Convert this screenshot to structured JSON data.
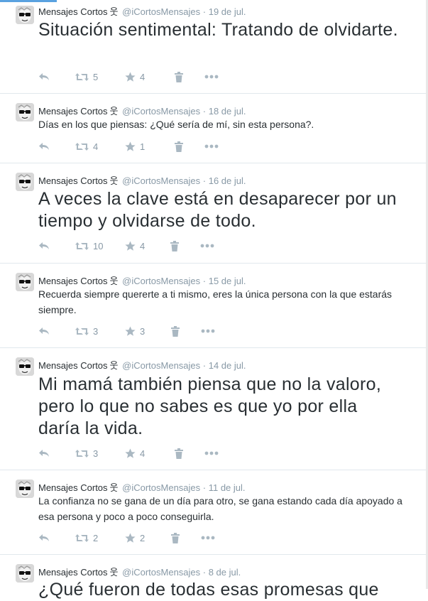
{
  "tweets": [
    {
      "name": "Mensajes Cortos",
      "glyph": "웃",
      "handle": "@iCortosMensajes",
      "date": "19 de jul.",
      "text": "Situación sentimental: Tratando de olvidarte.",
      "retweets": "5",
      "favorites": "4"
    },
    {
      "name": "Mensajes Cortos",
      "glyph": "웃",
      "handle": "@iCortosMensajes",
      "date": "18 de jul.",
      "text": "Días en los que piensas: ¿Qué sería de mí, sin esta persona?.",
      "retweets": "4",
      "favorites": "1"
    },
    {
      "name": "Mensajes Cortos",
      "glyph": "웃",
      "handle": "@iCortosMensajes",
      "date": "16 de jul.",
      "text": "A veces la clave está en desaparecer por un tiempo y olvidarse de todo.",
      "retweets": "10",
      "favorites": "4"
    },
    {
      "name": "Mensajes Cortos",
      "glyph": "웃",
      "handle": "@iCortosMensajes",
      "date": "15 de jul.",
      "text": "Recuerda siempre quererte a ti mismo, eres la única persona con la que estarás siempre.",
      "retweets": "3",
      "favorites": "3"
    },
    {
      "name": "Mensajes Cortos",
      "glyph": "웃",
      "handle": "@iCortosMensajes",
      "date": "14 de jul.",
      "text": "Mi mamá también piensa que no la valoro, pero lo que no sabes es que yo por ella daría la vida.",
      "retweets": "3",
      "favorites": "4"
    },
    {
      "name": "Mensajes Cortos",
      "glyph": "웃",
      "handle": "@iCortosMensajes",
      "date": "11 de jul.",
      "text": "La confianza no se gana de un día para otro, se gana estando cada día apoyado a esa persona y poco a poco conseguirla.",
      "retweets": "2",
      "favorites": "2"
    },
    {
      "name": "Mensajes Cortos",
      "glyph": "웃",
      "handle": "@iCortosMensajes",
      "date": "8 de jul.",
      "text": "¿Qué fueron de todas esas promesas que",
      "retweets": "",
      "favorites": ""
    }
  ]
}
